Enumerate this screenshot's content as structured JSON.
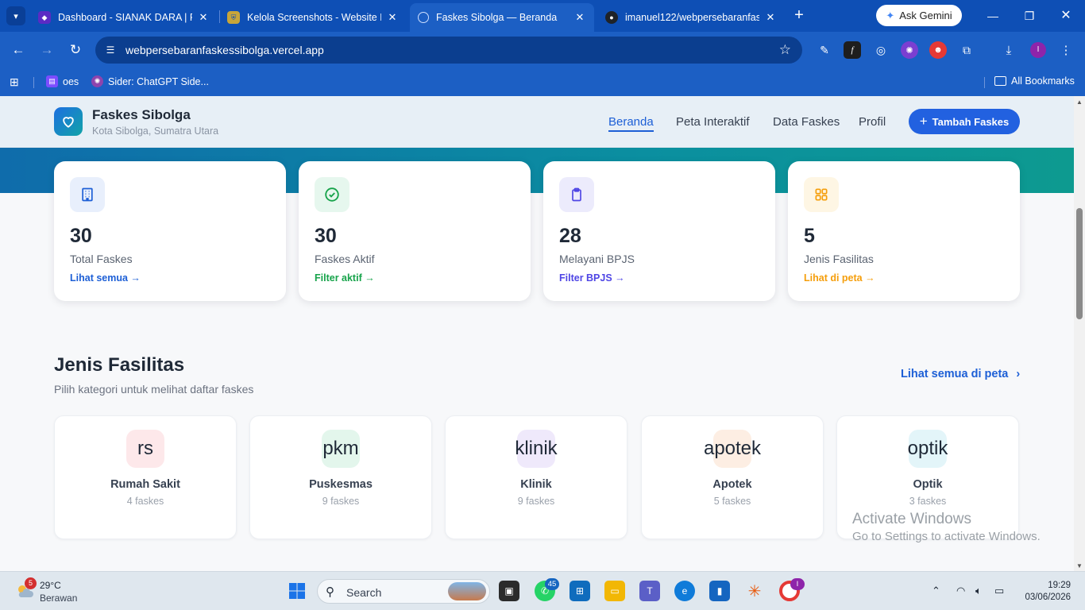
{
  "browser": {
    "tabs": [
      {
        "title": "Dashboard - SIANAK DARA | Po",
        "favicon": "sianak-icon"
      },
      {
        "title": "Kelola Screenshots - Website Pe",
        "favicon": "crest-icon"
      },
      {
        "title": "Faskes Sibolga — Beranda",
        "favicon": "globe-icon",
        "active": true
      },
      {
        "title": "imanuel122/webpersebaranfask",
        "favicon": "github-icon"
      }
    ],
    "gemini_label": "Ask Gemini",
    "url": "webpersebaranfaskessibolga.vercel.app",
    "profile_initial": "I",
    "bookmarks": [
      {
        "label": "oes"
      },
      {
        "label": "Sider: ChatGPT Side..."
      }
    ],
    "all_bookmarks_label": "All Bookmarks"
  },
  "site": {
    "brand": "Faskes Sibolga",
    "brand_sub": "Kota Sibolga, Sumatra Utara",
    "menu": [
      {
        "label": "Beranda",
        "active": true
      },
      {
        "label": "Peta Interaktif"
      },
      {
        "label": "Data Faskes"
      },
      {
        "label": "Profil"
      }
    ],
    "cta_label": "Tambah Faskes",
    "accent": "#2261e0"
  },
  "stats": [
    {
      "value": "30",
      "label": "Total Faskes",
      "link": "Lihat semua →",
      "color": "#1d5fd6",
      "icon": "building-icon"
    },
    {
      "value": "30",
      "label": "Faskes Aktif",
      "link": "Filter aktif →",
      "color": "#16a34a",
      "icon": "check-circle-icon"
    },
    {
      "value": "28",
      "label": "Melayani BPJS",
      "link": "Filter BPJS →",
      "color": "#4f46e5",
      "icon": "clipboard-icon"
    },
    {
      "value": "5",
      "label": "Jenis Fasilitas",
      "link": "Lihat di peta →",
      "color": "#f59e0b",
      "icon": "grid-icon"
    }
  ],
  "section": {
    "title": "Jenis Fasilitas",
    "subtitle": "Pilih kategori untuk melihat daftar faskes",
    "see_all": "Lihat semua di peta"
  },
  "categories": [
    {
      "code": "rs",
      "name": "Rumah Sakit",
      "count": "4 faskes",
      "bg": "#fde8ea"
    },
    {
      "code": "pkm",
      "name": "Puskesmas",
      "count": "9 faskes",
      "bg": "#e3f6ec"
    },
    {
      "code": "klinik",
      "name": "Klinik",
      "count": "9 faskes",
      "bg": "#efe9fb"
    },
    {
      "code": "apotek",
      "name": "Apotek",
      "count": "5 faskes",
      "bg": "#fdeee3"
    },
    {
      "code": "optik",
      "name": "Optik",
      "count": "3 faskes",
      "bg": "#e3f5f9"
    }
  ],
  "watermark": {
    "line1": "Activate Windows",
    "line2": "Go to Settings to activate Windows."
  },
  "taskbar": {
    "weather_badge": "5",
    "temperature": "29°C",
    "condition": "Berawan",
    "search_label": "Search",
    "whatsapp_badge": "45",
    "time": "19:29",
    "date": "03/06/2026"
  }
}
